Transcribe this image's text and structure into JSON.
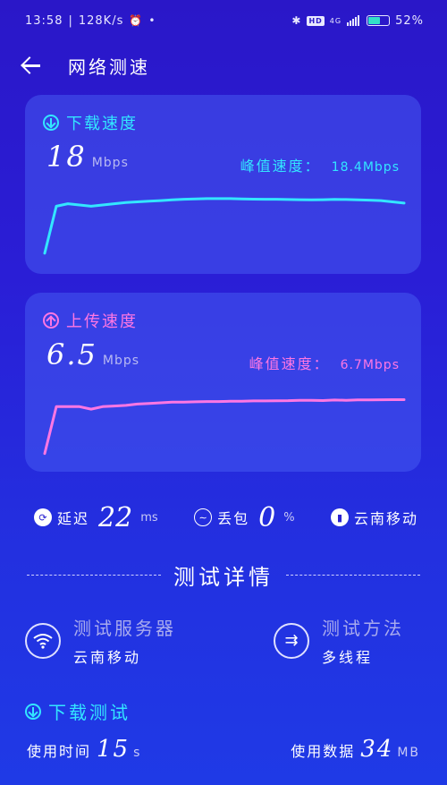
{
  "status_bar": {
    "time": "13:58",
    "net_speed": "128K/s",
    "network": "4G",
    "battery_percent": "52%",
    "battery_level": 0.52,
    "icons": [
      "alarm-icon",
      "notification-icon",
      "bluetooth-icon",
      "hd-icon",
      "signal-icon",
      "battery-icon"
    ]
  },
  "header": {
    "title": "网络测速"
  },
  "download": {
    "label": "下载速度",
    "speed": "18",
    "unit": "Mbps",
    "peak_label": "峰值速度：",
    "peak_value": "18.4Mbps",
    "color": "#33e6ff",
    "samples": [
      5,
      42,
      44,
      43,
      42,
      43,
      44,
      45,
      45.5,
      46,
      46.5,
      47,
      47.5,
      47.8,
      48,
      48,
      48,
      47.8,
      47.6,
      47.5,
      47.5,
      47.3,
      47.2,
      47,
      47.2,
      47.4,
      47.3,
      47.1,
      46.8,
      46.5,
      45.5,
      44.5
    ]
  },
  "upload": {
    "label": "上传速度",
    "speed": "6.5",
    "unit": "Mbps",
    "peak_label": "峰值速度：",
    "peak_value": "6.7Mbps",
    "color": "#ff77e3",
    "samples": [
      3,
      40,
      40,
      40,
      38,
      40,
      40.5,
      41,
      42,
      42.5,
      43,
      43.5,
      43.5,
      43.8,
      44,
      44,
      44.2,
      44.2,
      44.5,
      44.5,
      44.6,
      44.7,
      45,
      45,
      44.8,
      45.2,
      45,
      45.3,
      45.3,
      45.4,
      45.5,
      45.5
    ]
  },
  "stats": {
    "latency": {
      "label": "延迟",
      "value": "22",
      "unit": "ms"
    },
    "packet_loss": {
      "label": "丢包",
      "value": "0",
      "unit": "%"
    },
    "operator": {
      "label": "云南移动"
    }
  },
  "details": {
    "section_title": "测试详情",
    "server": {
      "label": "测试服务器",
      "value": "云南移动"
    },
    "method": {
      "label": "测试方法",
      "value": "多线程"
    }
  },
  "download_test": {
    "label": "下载测试",
    "time_label": "使用时间",
    "time_value": "15",
    "time_unit": "s",
    "data_label": "使用数据",
    "data_value": "34",
    "data_unit": "MB"
  }
}
